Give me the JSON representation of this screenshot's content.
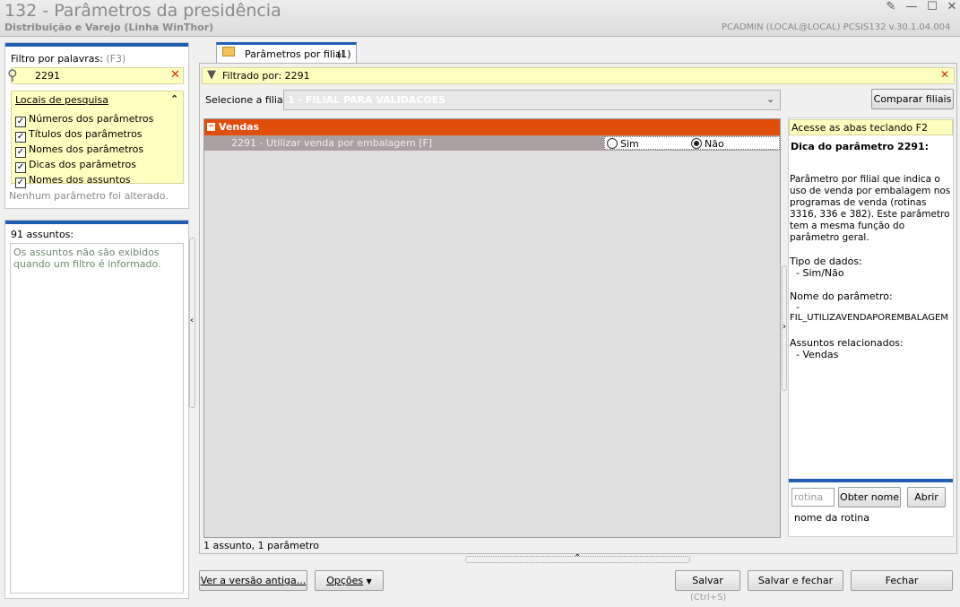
{
  "window": {
    "title": "132 - Parâmetros da presidência",
    "subtitle": "Distribuição e Varejo (Linha WinThor)",
    "user_info": "PCADMIN (LOCAL@LOCAL)   PCSIS132  v.30.1.04.004"
  },
  "filter": {
    "label": "Filtro por palavras:",
    "shortcut": "(F3)",
    "value": "2291",
    "locations_title": "Locais de pesquisa",
    "options": [
      {
        "label": "Números dos parâmetros",
        "checked": true
      },
      {
        "label": "Títulos dos parâmetros",
        "checked": true
      },
      {
        "label": "Nomes dos parâmetros",
        "checked": true
      },
      {
        "label": "Dicas dos parâmetros",
        "checked": true
      },
      {
        "label": "Nomes dos assuntos",
        "checked": true
      }
    ],
    "status": "Nenhum parâmetro foi alterado."
  },
  "subjects": {
    "count_label": "91 assuntos:",
    "message": "Os assuntos não são exibidos quando um filtro é informado."
  },
  "tab": {
    "label": "Parâmetros por filial",
    "count": "(1)"
  },
  "filter_bar": {
    "text": "Filtrado por: 2291"
  },
  "branch": {
    "label": "Selecione a filial:",
    "value": "1 - FILIAL PARA VALIDACOES",
    "compare_button": "Comparar filiais"
  },
  "grid": {
    "group": "Vendas",
    "rows": [
      {
        "label": "2291 - Utilizar venda por embalagem [F]",
        "option_yes": "Sim",
        "option_no": "Não",
        "selected": "Não"
      }
    ],
    "summary": "1 assunto, 1 parâmetro"
  },
  "hint": {
    "banner": "Acesse as abas teclando F2",
    "title": "Dica do parâmetro 2291:",
    "description": "Parâmetro por filial que indica o uso de venda por embalagem nos programas de venda (rotinas 3316, 336 e 382). Este parâmetro tem a mesma função do parâmetro geral.",
    "data_type_label": "Tipo de dados:",
    "data_type_value": "- Sim/Não",
    "param_name_label": "Nome do parâmetro:",
    "param_name_dash": "-",
    "param_name_value": "FIL_UTILIZAVENDAPOREMBALAGEM",
    "related_label": "Assuntos relacionados:",
    "related_value": "- Vendas"
  },
  "routine": {
    "placeholder": "rotina",
    "get_name_button": "Obter nome",
    "open_button": "Abrir",
    "name_label": "nome da rotina"
  },
  "footer": {
    "old_version_button": "Ver a versão antiga...",
    "options_button": "Opções",
    "save_button": "Salvar",
    "save_shortcut": "(Ctrl+S)",
    "save_close_button": "Salvar e fechar",
    "close_button": "Fechar"
  },
  "colors": {
    "group_header": "#e04e0c",
    "accent_blue": "#1f5fb1",
    "yellow_bg": "#ffffc0"
  }
}
